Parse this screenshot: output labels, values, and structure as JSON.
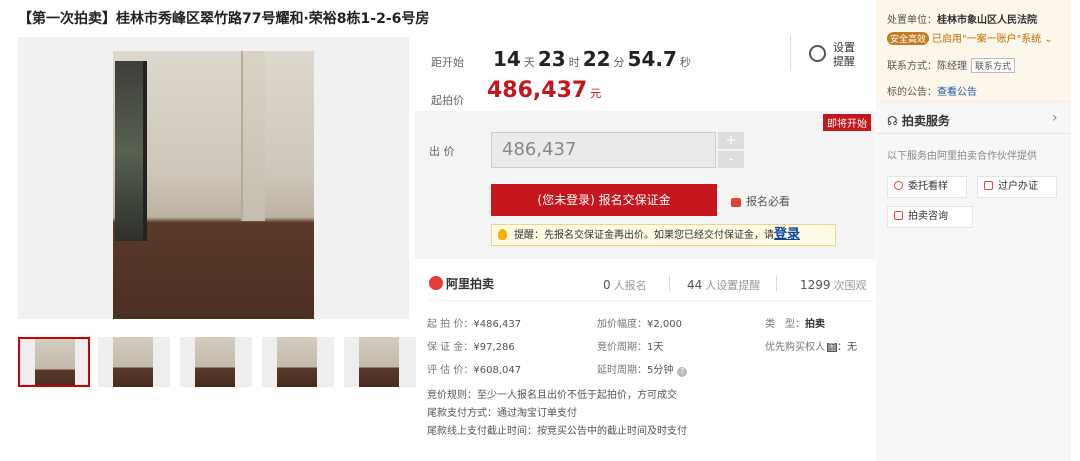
{
  "listing": {
    "title": "【第一次拍卖】桂林市秀峰区翠竹路77号耀和·荣裕8栋1-2-6号房"
  },
  "countdown": {
    "label": "距开始",
    "days": "14",
    "days_unit": "天",
    "hours": "23",
    "hours_unit": "时",
    "minutes": "22",
    "minutes_unit": "分",
    "seconds": "54.7",
    "seconds_unit": "秒"
  },
  "starting_price": {
    "label": "起拍价",
    "value": "486,437",
    "unit": "元"
  },
  "remind": {
    "label": "设置提醒",
    "icon": "alarm-clock-icon"
  },
  "bid": {
    "status_badge": "即将开始",
    "label": "出 价",
    "input_value": "486,437",
    "plus": "+",
    "minus": "-",
    "signup_button": "(您未登录) 报名交保证金",
    "must_read": "报名必看",
    "tip_prefix": "提醒：先报名交保证金再出价。如果您已经交付保证金，请",
    "tip_login": "登录"
  },
  "stats": {
    "brand": "阿里拍卖",
    "signups": "0",
    "signups_label": "人报名",
    "reminders": "44",
    "reminders_label": "人设置提醒",
    "views": "1299",
    "views_label": "次围观"
  },
  "details": {
    "start_price_k": "起 拍 价：",
    "start_price_v": "¥486,437",
    "increment_k": "加价幅度：",
    "increment_v": "¥2,000",
    "type_k": "类　型：",
    "type_v": "拍卖",
    "deposit_k": "保 证 金：",
    "deposit_v": "¥97,286",
    "cycle_k": "竞价周期：",
    "cycle_v": "1天",
    "priority_k": "优先购买权人",
    "priority_icon": "图",
    "priority_v": "：无",
    "appraisal_k": "评 估 价：",
    "appraisal_v": "¥608,047",
    "delay_k": "延时周期：",
    "delay_v": "5分钟",
    "rule1": "竞价规则：至少一人报名且出价不低于起拍价，方可成交",
    "rule2": "尾款支付方式：通过淘宝订单支付",
    "rule3": "尾款线上支付截止时间：按竞买公告中的截止时间及时支付"
  },
  "sidebar": {
    "court_k": "处置单位：",
    "court_v": "桂林市象山区人民法院",
    "safe_badge": "安全高效",
    "safe_text": "已启用\"一案一账户\"系统",
    "contact_k": "联系方式：",
    "contact_v": "陈经理",
    "contact_btn": "联系方式",
    "notice_k": "标的公告：",
    "notice_link": "查看公告",
    "service_title": "拍卖服务",
    "service_desc": "以下服务由阿里拍卖合作伙伴提供",
    "btn_view": "委托看样",
    "btn_transfer": "过户办证",
    "btn_consult": "拍卖咨询"
  },
  "colors": {
    "accent_red": "#c4161c",
    "link_blue": "#1a5cb0"
  }
}
